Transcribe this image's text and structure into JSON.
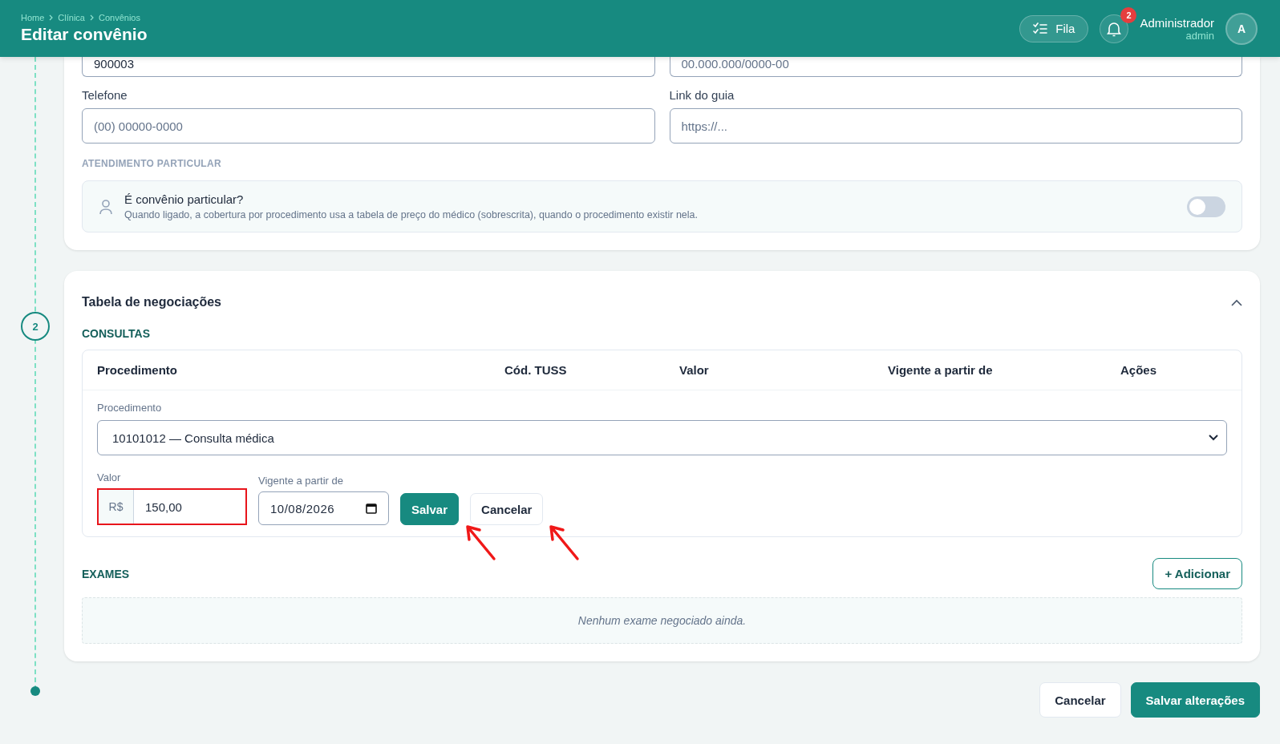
{
  "header": {
    "breadcrumbs": [
      "Home",
      "Clínica",
      "Convênios"
    ],
    "title": "Editar convênio",
    "queue_button": "Fila",
    "notifications": {
      "count": "2"
    },
    "user": {
      "name": "Administrador",
      "role": "admin",
      "initial": "A"
    }
  },
  "general": {
    "fields": [
      {
        "value": "900003"
      },
      {
        "placeholder": "00.000.000/0000-00"
      },
      {
        "label": "Telefone",
        "placeholder": "(00) 00000-0000"
      },
      {
        "label": "Link do guia",
        "placeholder": "https://..."
      }
    ],
    "section": "ATENDIMENTO PARTICULAR",
    "private_toggle": {
      "title": "É convênio particular?",
      "description": "Quando ligado, a cobertura por procedimento usa a tabela de preço do médico (sobrescrita), quando o procedimento existir nela.",
      "on": false
    }
  },
  "negotiations": {
    "step": "2",
    "title": "Tabela de negociações",
    "expanded": true,
    "consultas": {
      "heading": "CONSULTAS",
      "columns": [
        "Procedimento",
        "Cód. TUSS",
        "Valor",
        "Vigente a partir de",
        "Ações"
      ],
      "edit_row": {
        "procedure_label": "Procedimento",
        "procedure": "10101012 — Consulta médica",
        "value_label": "Valor",
        "currency": "R$",
        "value": "150,00",
        "value_highlighted": true,
        "date_label": "Vigente a partir de",
        "date": "10/08/2026",
        "save": "Salvar",
        "cancel": "Cancelar"
      }
    },
    "exames": {
      "heading": "EXAMES",
      "add_button": "+ Adicionar",
      "empty": "Nenhum exame negociado ainda."
    }
  },
  "annotation_arrows": [
    {
      "kind": "arrow"
    },
    {
      "kind": "arrow"
    }
  ],
  "footer": {
    "buttons": [
      {
        "label": "Cancelar",
        "kind": "secondary"
      },
      {
        "label": "Salvar alterações",
        "kind": "primary"
      }
    ]
  }
}
